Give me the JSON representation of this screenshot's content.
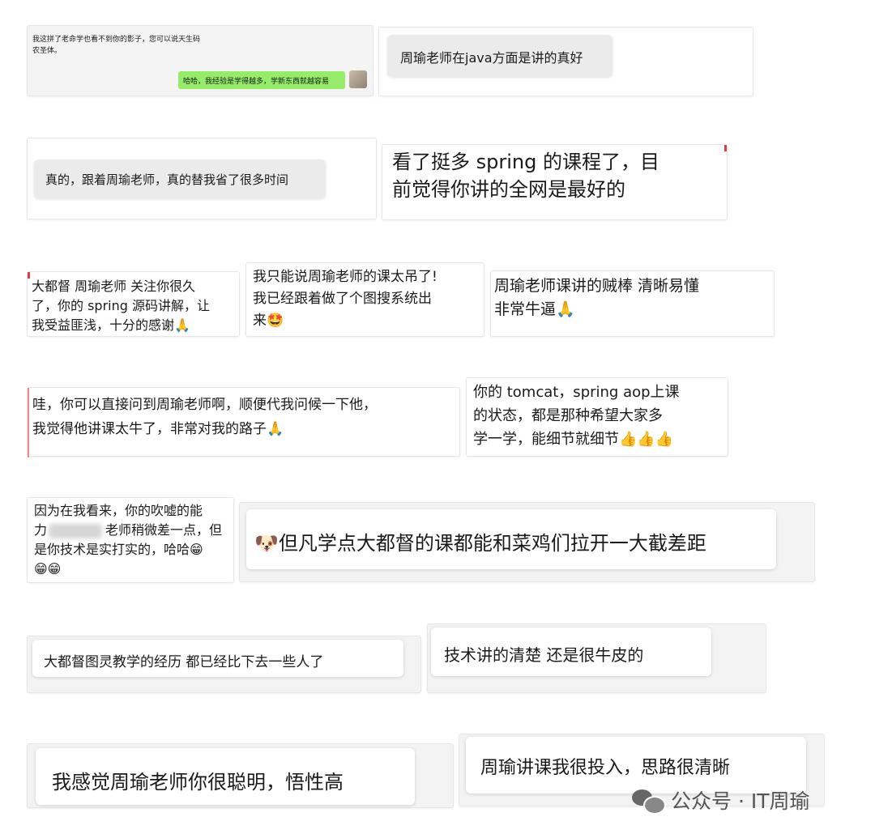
{
  "comments": {
    "c1": {
      "line1": "我这拼了老命学也看不到你的影子，您可以说天生码",
      "line2": "农圣体。",
      "reply": "哈哈，我经验是学得越多，学新东西就越容易"
    },
    "c2": "周瑜老师在java方面是讲的真好",
    "c3": "真的，跟着周瑜老师，真的替我省了很多时间",
    "c4": {
      "line1": "看了挺多 spring 的课程了，目",
      "line2": "前觉得你讲的全网是最好的"
    },
    "c5": {
      "line1": "大都督 周瑜老师 关注你很久",
      "line2": "了，你的 spring 源码讲解，让",
      "line3": "我受益匪浅，十分的感谢🙏"
    },
    "c6": {
      "line1": "我只能说周瑜老师的课太吊了!",
      "line2": "我已经跟着做了个图搜系统出",
      "line3": "来🤩"
    },
    "c7": {
      "line1": "周瑜老师课讲的贼棒 清晰易懂",
      "line2": "非常牛逼🙏"
    },
    "c8": {
      "line1": "哇，你可以直接问到周瑜老师啊，顺便代我问候一下他，",
      "line2": "我觉得他讲课太牛了，非常对我的路子🙏"
    },
    "c9": {
      "line1": "你的 tomcat，spring aop上课",
      "line2": "的状态，都是那种希望大家多",
      "line3": "学一学，能细节就细节👍👍👍"
    },
    "c10": {
      "line1": "因为在我看来，你的吹嘘的能",
      "line2a": "力",
      "line2b": "老师稍微差一点，但",
      "line3": "是你技术是实打实的，哈哈😁",
      "line4": "😁😁"
    },
    "c11": "🐶但凡学点大都督的课都能和菜鸡们拉开一大截差距",
    "c12": "大都督图灵教学的经历  都已经比下去一些人了",
    "c13": "技术讲的清楚 还是很牛皮的",
    "c14": "我感觉周瑜老师你很聪明，悟性高",
    "c15": "周瑜讲课我很投入，思路很清晰"
  },
  "watermark": {
    "icon": "wechat-icon",
    "text": "公众号 · IT周瑜"
  },
  "colors": {
    "wechat_green": "#95ec69",
    "bubble_gray": "#ebebeb",
    "card_bg": "#f4f4f4"
  }
}
